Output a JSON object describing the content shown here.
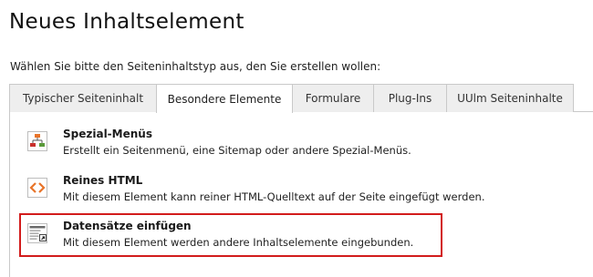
{
  "page": {
    "title": "Neues Inhaltselement",
    "instruction": "Wählen Sie bitte den Seiteninhaltstyp aus, den Sie erstellen wollen:"
  },
  "tabs": [
    {
      "label": "Typischer Seiteninhalt",
      "active": false
    },
    {
      "label": "Besondere Elemente",
      "active": true
    },
    {
      "label": "Formulare",
      "active": false
    },
    {
      "label": "Plug-Ins",
      "active": false
    },
    {
      "label": "UUlm Seiteninhalte",
      "active": false
    }
  ],
  "items": [
    {
      "title": "Spezial-Menüs",
      "description": "Erstellt ein Seitenmenü, eine Sitemap oder andere Spezial-Menüs.",
      "icon": "sitemap-icon"
    },
    {
      "title": "Reines HTML",
      "description": "Mit diesem Element kann reiner HTML-Quelltext auf der Seite eingefügt werden.",
      "icon": "html-code-icon"
    },
    {
      "title": "Datensätze einfügen",
      "description": "Mit diesem Element werden andere Inhaltselemente eingebunden.",
      "icon": "insert-records-icon",
      "highlighted": true
    }
  ],
  "colors": {
    "highlight_border": "#d21c1c",
    "tab_inactive_bg": "#eeeeee",
    "tab_border": "#c9c9c9",
    "icon_orange": "#e8742a",
    "icon_green": "#5a9a3a",
    "icon_red": "#c9302c"
  }
}
